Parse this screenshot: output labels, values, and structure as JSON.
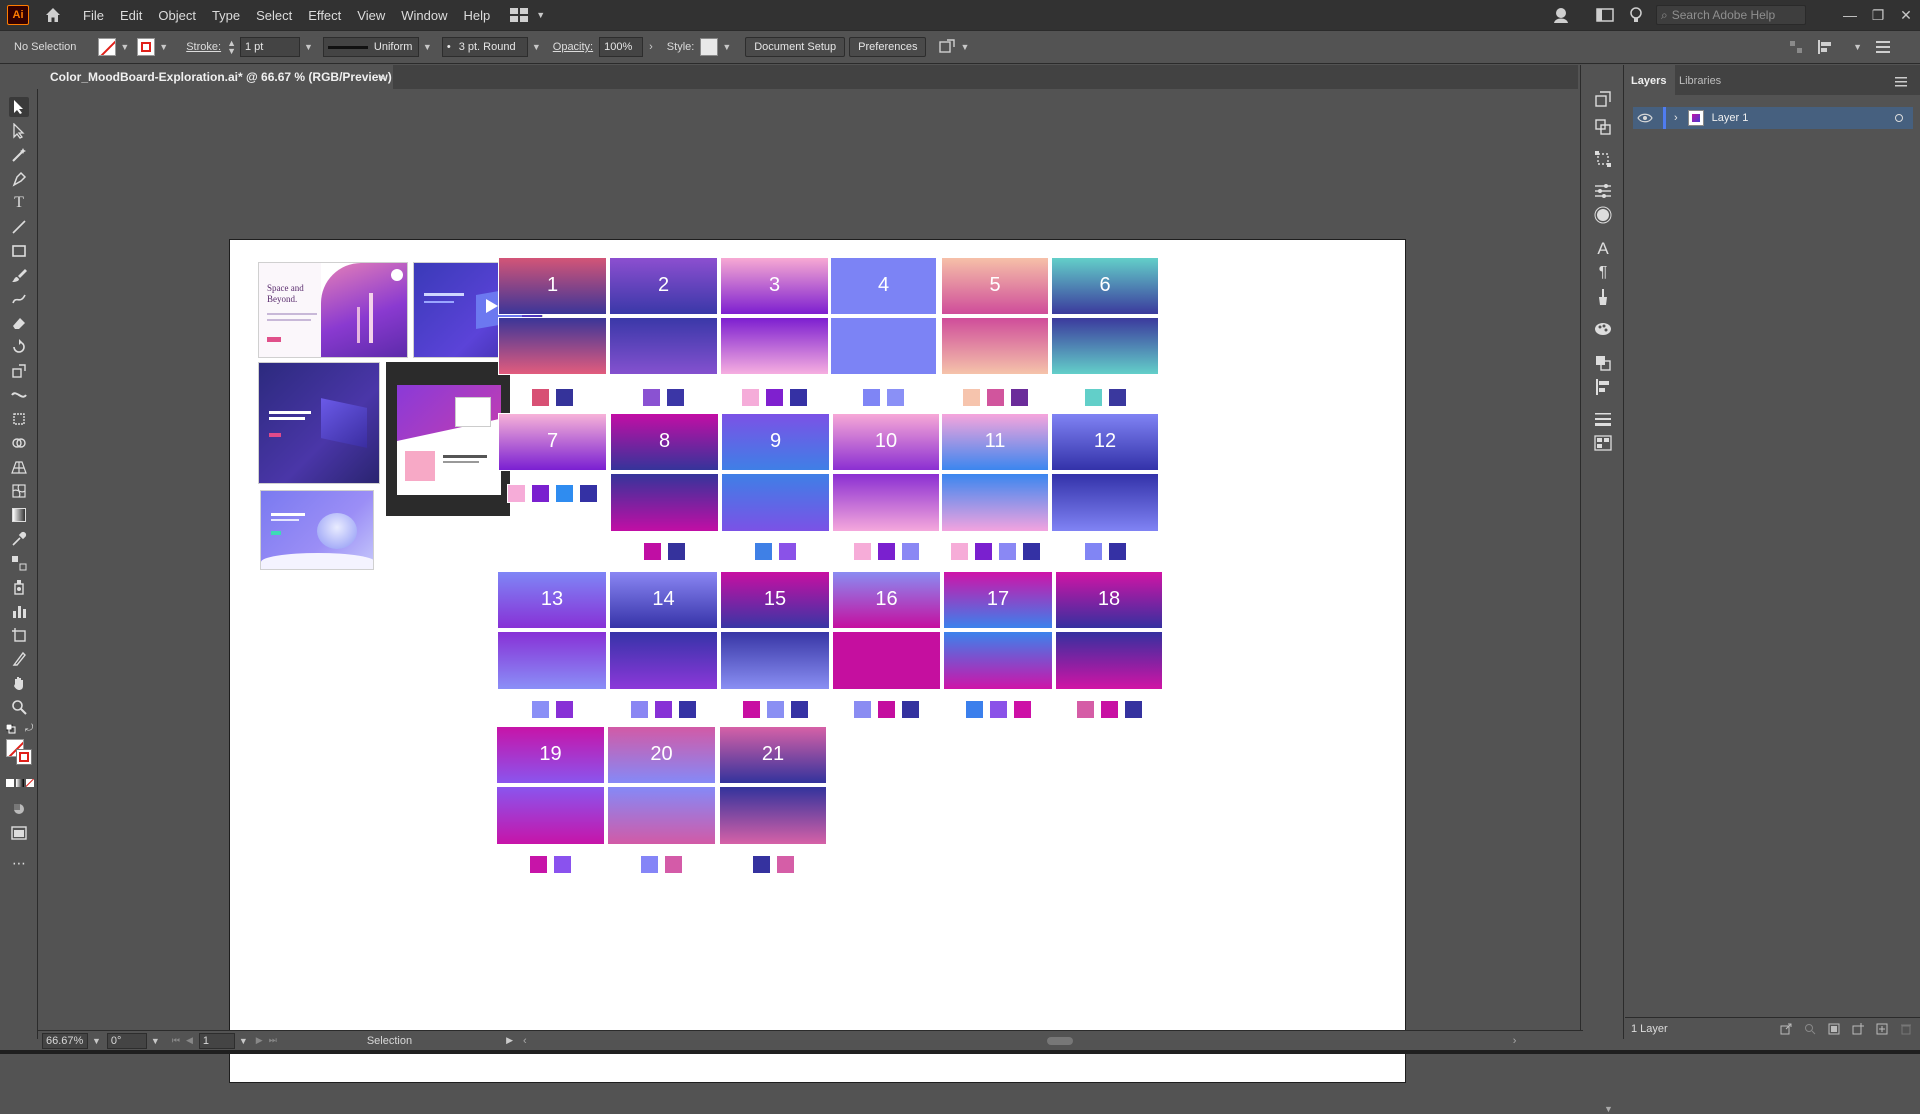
{
  "menubar": {
    "app_logo": "Ai",
    "items": [
      "File",
      "Edit",
      "Object",
      "Type",
      "Select",
      "Effect",
      "View",
      "Window",
      "Help"
    ],
    "search_placeholder": "Search Adobe Help"
  },
  "control": {
    "selection": "No Selection",
    "stroke_label": "Stroke:",
    "stroke_weight": "1 pt",
    "profile": "Uniform",
    "brush": "3 pt. Round",
    "opacity_label": "Opacity:",
    "opacity_value": "100%",
    "style_label": "Style:",
    "document_setup": "Document Setup",
    "preferences": "Preferences"
  },
  "document": {
    "tab_title": "Color_MoodBoard-Exploration.ai* @ 66.67 % (RGB/Preview)",
    "close_glyph": "×"
  },
  "thumbnails": {
    "space_title": "Space and Beyond."
  },
  "tiles": [
    {
      "n": "1",
      "top": "#d35577",
      "mid": "#3b3598",
      "bot": "#e25c7d"
    },
    {
      "n": "2",
      "top": "#8c4fd0",
      "mid": "#3a38a8",
      "bot": "#8451cf"
    },
    {
      "n": "3",
      "top": "#f7a9d3",
      "mid": "#7d1fd0",
      "bot": "#f6aee0"
    },
    {
      "n": "4",
      "top": "#7c83f5",
      "mid": "#7c83f5",
      "bot": "#7c83f5"
    },
    {
      "n": "5",
      "top": "#f6c0a8",
      "mid": "#cf4d9a",
      "bot": "#f5c3aa"
    },
    {
      "n": "6",
      "top": "#63cfc9",
      "mid": "#3b3a9d",
      "bot": "#63cfc9"
    },
    {
      "n": "7",
      "top": "#f7b2d8",
      "mid": "#7a1fd2",
      "bot": "#2a8bf0"
    },
    {
      "n": "8",
      "top": "#c20ea5",
      "mid": "#35349a",
      "bot": "#c20ea5"
    },
    {
      "n": "9",
      "top": "#7b52e6",
      "mid": "#3f7fe6",
      "bot": "#7b52e6"
    },
    {
      "n": "10",
      "top": "#f7a8d7",
      "mid": "#8b2fd2",
      "bot": "#f5a8dc"
    },
    {
      "n": "11",
      "top": "#f6a5dc",
      "mid": "#3b86ef",
      "bot": "#f3a3df"
    },
    {
      "n": "12",
      "top": "#8083f4",
      "mid": "#3332a9",
      "bot": "#8083f4"
    },
    {
      "n": "13",
      "top": "#7f86f6",
      "mid": "#8731d6",
      "bot": "#8a8ff7"
    },
    {
      "n": "14",
      "top": "#8a86f3",
      "mid": "#3633a8",
      "bot": "#8c38d9"
    },
    {
      "n": "15",
      "top": "#c80fa2",
      "mid": "#3836a5",
      "bot": "#8a8ff3"
    },
    {
      "n": "16",
      "top": "#8a8cf2",
      "mid": "#c50f9f",
      "bot": "#c50f9f"
    },
    {
      "n": "17",
      "top": "#cf13a8",
      "mid": "#3b82ec",
      "bot": "#cf13a8"
    },
    {
      "n": "18",
      "top": "#d114a5",
      "mid": "#35309f",
      "bot": "#d114a5"
    },
    {
      "n": "19",
      "top": "#c714a8",
      "mid": "#8a55ee",
      "bot": "#c714a8"
    },
    {
      "n": "20",
      "top": "#d25aa6",
      "mid": "#8589f7",
      "bot": "#d25aa6"
    },
    {
      "n": "21",
      "top": "#d661a7",
      "mid": "#33339c",
      "bot": "#d661a7"
    }
  ],
  "chips": [
    [
      "#d85074",
      "#35339a"
    ],
    [
      "#8a52d2",
      "#3b36a6"
    ],
    [
      "#f5acd9",
      "#7f20cf",
      "#3531a4"
    ],
    [
      "#7f85f5",
      "#8a90f6"
    ],
    [
      "#f6c4ad",
      "#d1559d",
      "#6b2c9a"
    ],
    [
      "#62cfc9",
      "#3a389e"
    ],
    [
      "#f6acd8",
      "#7a20cf",
      "#2f8cf0",
      "#3431a4"
    ],
    [
      "#c00ea4",
      "#35329c"
    ],
    [
      "#3f80e6",
      "#8a52e8"
    ],
    [
      "#f6acd8",
      "#7a20cf",
      "#8a88f4"
    ],
    [
      "#f6acd8",
      "#7a20cf",
      "#8a88f4",
      "#3431a4"
    ],
    [
      "#8185f4",
      "#3531a4"
    ],
    [
      "#8a8ff6",
      "#8830d6"
    ],
    [
      "#8a86f3",
      "#8731d6",
      "#3532a4"
    ],
    [
      "#c80fa2",
      "#8a8ff3",
      "#3532a4"
    ],
    [
      "#8a8cf2",
      "#c40e9f",
      "#34329f"
    ],
    [
      "#3b7fec",
      "#8a52e8",
      "#cd10a6"
    ],
    [
      "#d55da6",
      "#c810a3",
      "#35329f"
    ],
    [
      "#c714a8",
      "#8a52ee"
    ],
    [
      "#8585f7",
      "#d45ba8"
    ],
    [
      "#35329f",
      "#d55ea7"
    ]
  ],
  "layers_panel": {
    "tab_layers": "Layers",
    "tab_libraries": "Libraries",
    "layer_name": "Layer 1",
    "footer_count": "1 Layer"
  },
  "statusbar": {
    "zoom": "66.67%",
    "rotation": "0°",
    "artboard": "1",
    "tool": "Selection"
  }
}
